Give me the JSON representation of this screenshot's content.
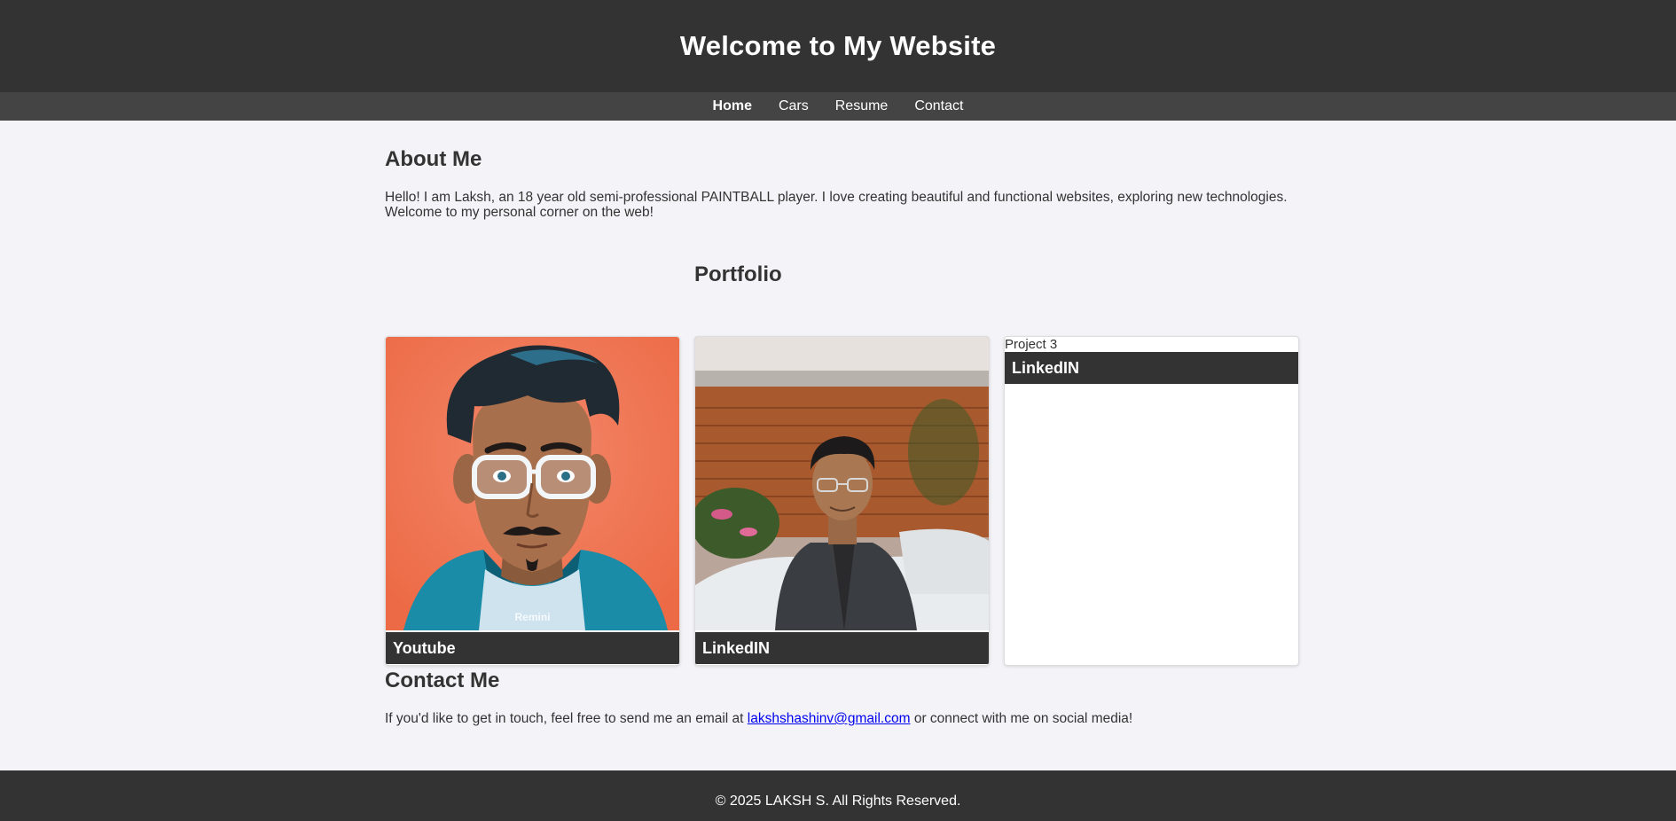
{
  "header": {
    "title": "Welcome to My Website"
  },
  "nav": {
    "items": [
      {
        "label": "Home",
        "active": true
      },
      {
        "label": "Cars"
      },
      {
        "label": "Resume"
      },
      {
        "label": "Contact"
      }
    ]
  },
  "about": {
    "heading": "About Me",
    "text": "Hello! I am Laksh, an 18 year old semi-professional PAINTBALL player. I love creating beautiful and functional websites, exploring new technologies. Welcome to my personal corner on the web!"
  },
  "portfolio": {
    "heading": "Portfolio",
    "cards": [
      {
        "caption": "Youtube",
        "image_watermark": "Remini"
      },
      {
        "caption": "LinkedIN"
      },
      {
        "caption": "LinkedIN",
        "image_alt": "Project 3"
      }
    ]
  },
  "contact": {
    "heading": "Contact Me",
    "text_before": "If you'd like to get in touch, feel free to send me an email at",
    "email": "lakshshashinv@gmail.com",
    "text_after": "or connect with me on social media!"
  },
  "footer": {
    "text": "© 2025 LAKSH S. All Rights Reserved."
  },
  "colors": {
    "header_bg": "#333333",
    "nav_bg": "#444444",
    "page_bg": "#f4f4f8",
    "link": "#0000ee"
  }
}
